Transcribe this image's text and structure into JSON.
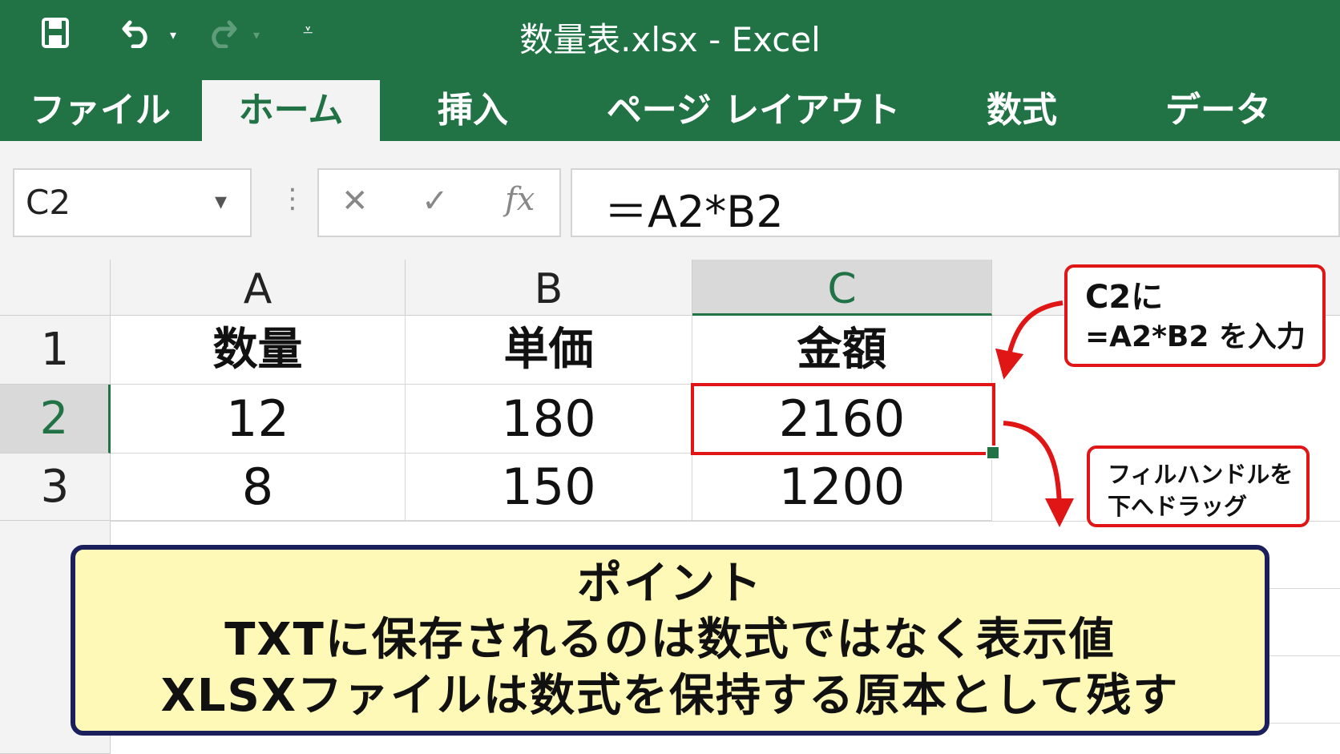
{
  "title_bar": {
    "title": "数量表.xlsx - Excel",
    "icons": [
      "save-icon",
      "undo-icon",
      "redo-icon",
      "customize-qat-icon"
    ]
  },
  "ribbon": {
    "tabs": [
      "ファイル",
      "ホーム",
      "挿入",
      "ページ レイアウト",
      "数式",
      "データ"
    ],
    "active_tab": "ホーム"
  },
  "formula_bar": {
    "name_box": "C2",
    "cancel_glyph": "✕",
    "enter_glyph": "✓",
    "fx_glyph": "fx",
    "formula": "＝A2*B2"
  },
  "sheet": {
    "columns": [
      "A",
      "B",
      "C"
    ],
    "selected_column": "C",
    "rows": [
      "1",
      "2",
      "3"
    ],
    "selected_row": "2",
    "cells": [
      [
        "数量",
        "単価",
        "金額"
      ],
      [
        "12",
        "180",
        "2160"
      ],
      [
        "8",
        "150",
        "1200"
      ]
    ],
    "selected_cell": "C2"
  },
  "callouts": {
    "input": {
      "line1": "C2に",
      "line2": "=A2*B2 を入力"
    },
    "drag": {
      "line1": "フィルハンドルを",
      "line2": "下へドラッグ"
    }
  },
  "point_box": {
    "title": "ポイント",
    "line1": "TXTに保存されるのは数式ではなく表示値",
    "line2": "XLSXファイルは数式を保持する原本として残す"
  },
  "colors": {
    "excel_green": "#217346",
    "highlight_red": "#e01515",
    "note_yellow": "#fff9b8",
    "note_border": "#1b1f5c"
  }
}
